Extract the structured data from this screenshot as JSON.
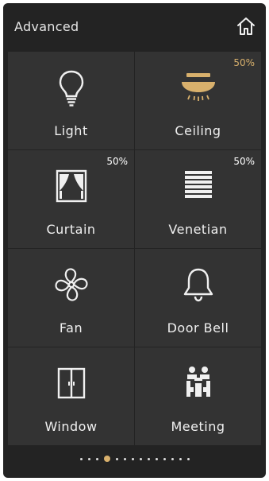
{
  "header": {
    "title": "Advanced"
  },
  "tiles": [
    {
      "label": "Light",
      "icon": "lightbulb-icon"
    },
    {
      "label": "Ceiling",
      "icon": "ceiling-lamp-icon",
      "percent": "50%"
    },
    {
      "label": "Curtain",
      "icon": "curtain-icon",
      "percent": "50%"
    },
    {
      "label": "Venetian",
      "icon": "venetian-blind-icon",
      "percent": "50%"
    },
    {
      "label": "Fan",
      "icon": "fan-icon"
    },
    {
      "label": "Door Bell",
      "icon": "bell-icon"
    },
    {
      "label": "Window",
      "icon": "window-icon"
    },
    {
      "label": "Meeting",
      "icon": "meeting-icon"
    }
  ],
  "pagination": {
    "total": 14,
    "active_index": 3
  },
  "colors": {
    "background": "#232323",
    "tile": "#333333",
    "accent": "#d8b06c",
    "text": "#f0f0f0"
  }
}
